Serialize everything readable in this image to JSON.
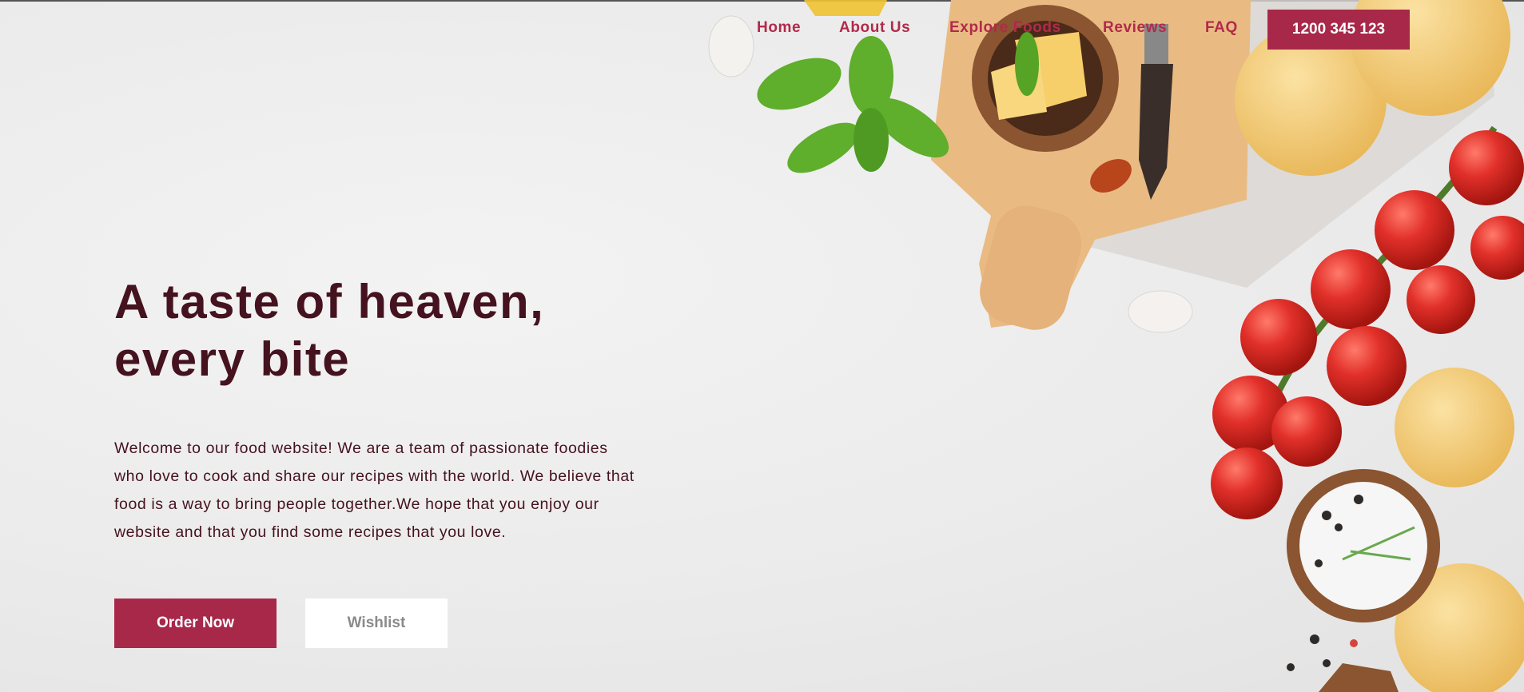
{
  "nav": {
    "links": [
      "Home",
      "About Us",
      "Explore Foods",
      "Reviews",
      "FAQ"
    ],
    "phone": "1200 345 123"
  },
  "hero": {
    "headline_line1": "A taste of heaven,",
    "headline_line2": "every bite",
    "intro": "Welcome to our food website! We are a team of passionate foodies who love to cook and share our recipes with the world. We believe that food is a way to bring people together.We hope that you enjoy our website and that you find some recipes that you love.",
    "order_label": "Order Now",
    "wishlist_label": "Wishlist"
  },
  "colors": {
    "brand": "#a8284a",
    "headline": "#45121f",
    "nav_link": "#b12a4a",
    "background": "#ececec"
  }
}
